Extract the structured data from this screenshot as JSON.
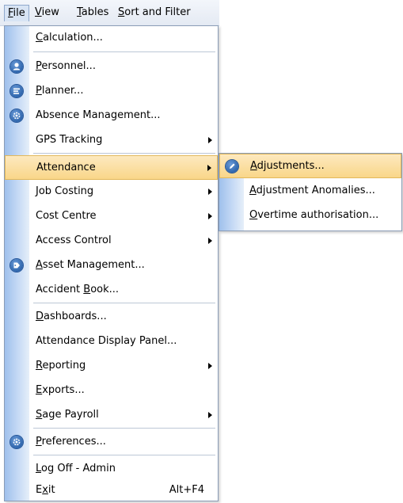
{
  "menubar": {
    "file": {
      "u": "F",
      "rest": "ile"
    },
    "view": {
      "u": "V",
      "rest": "iew"
    },
    "tables": {
      "u": "T",
      "rest": "ables"
    },
    "sort": {
      "pre": "",
      "u": "S",
      "rest": "ort and Filter"
    }
  },
  "menu": {
    "calculation": {
      "pre": "",
      "u": "C",
      "rest": "alculation..."
    },
    "personnel": {
      "pre": "",
      "u": "P",
      "rest": "ersonnel..."
    },
    "planner": {
      "pre": "",
      "u": "P",
      "rest": "lanner..."
    },
    "absence": {
      "pre": "",
      "u": "",
      "rest": "Absence Management..."
    },
    "gps": {
      "pre": "",
      "u": "",
      "rest": "GPS Tracking"
    },
    "attendance": {
      "pre": "",
      "u": "",
      "rest": "Attendance"
    },
    "job_costing": {
      "pre": "",
      "u": "",
      "rest": "Job Costing"
    },
    "cost_centre": {
      "pre": "",
      "u": "",
      "rest": "Cost Centre"
    },
    "access_control": {
      "pre": "",
      "u": "",
      "rest": "Access Control"
    },
    "asset": {
      "pre": "",
      "u": "A",
      "rest": "sset Management..."
    },
    "accident": {
      "pre": "Accident ",
      "u": "B",
      "rest": "ook..."
    },
    "dashboards": {
      "pre": "",
      "u": "D",
      "rest": "ashboards..."
    },
    "display_panel": {
      "pre": "",
      "u": "",
      "rest": "Attendance Display Panel..."
    },
    "reporting": {
      "pre": "",
      "u": "R",
      "rest": "eporting"
    },
    "exports": {
      "pre": "",
      "u": "E",
      "rest": "xports..."
    },
    "sage": {
      "pre": "",
      "u": "S",
      "rest": "age Payroll"
    },
    "preferences": {
      "pre": "",
      "u": "P",
      "rest": "references..."
    },
    "logoff": {
      "pre": "",
      "u": "L",
      "rest": "og Off - Admin"
    },
    "exit": {
      "pre": "E",
      "u": "x",
      "rest": "it",
      "shortcut": "Alt+F4"
    }
  },
  "submenu": {
    "adjustments": {
      "pre": "",
      "u": "A",
      "rest": "djustments..."
    },
    "anomalies": {
      "pre": "",
      "u": "A",
      "rest": "djustment Anomalies..."
    },
    "overtime": {
      "pre": "",
      "u": "O",
      "rest": "vertime authorisation..."
    }
  },
  "icons": {
    "personnel": "person-icon",
    "planner": "planner-icon",
    "absence": "gear-icon",
    "attendance_adjust": "pencil-icon",
    "asset": "tag-icon",
    "preferences": "gear-icon"
  },
  "colors": {
    "highlight_top": "#fde9bf",
    "highlight_bottom": "#f9d689",
    "highlight_border": "#e2b85a",
    "icon_strip": "#c6daf5",
    "icon_blue": "#2f66ad"
  }
}
